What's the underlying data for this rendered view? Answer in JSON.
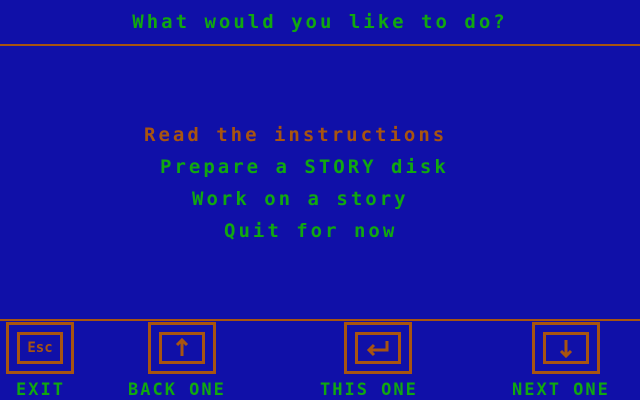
{
  "header": {
    "title": "What would you like to do?"
  },
  "menu": {
    "items": [
      {
        "label": "Read the instructions",
        "selected": true
      },
      {
        "label": "Prepare a STORY disk",
        "selected": false
      },
      {
        "label": "Work on a story",
        "selected": false
      },
      {
        "label": "Quit for now",
        "selected": false
      }
    ]
  },
  "keys": {
    "exit": {
      "cap": "Esc",
      "label": "EXIT"
    },
    "back": {
      "icon": "arrow-up-icon",
      "label": "BACK ONE"
    },
    "select": {
      "icon": "enter-arrow-icon",
      "label": "THIS ONE"
    },
    "next": {
      "icon": "arrow-down-icon",
      "label": "NEXT ONE"
    }
  },
  "colors": {
    "background": "#1010a8",
    "text": "#10a810",
    "highlight": "#a85410"
  }
}
